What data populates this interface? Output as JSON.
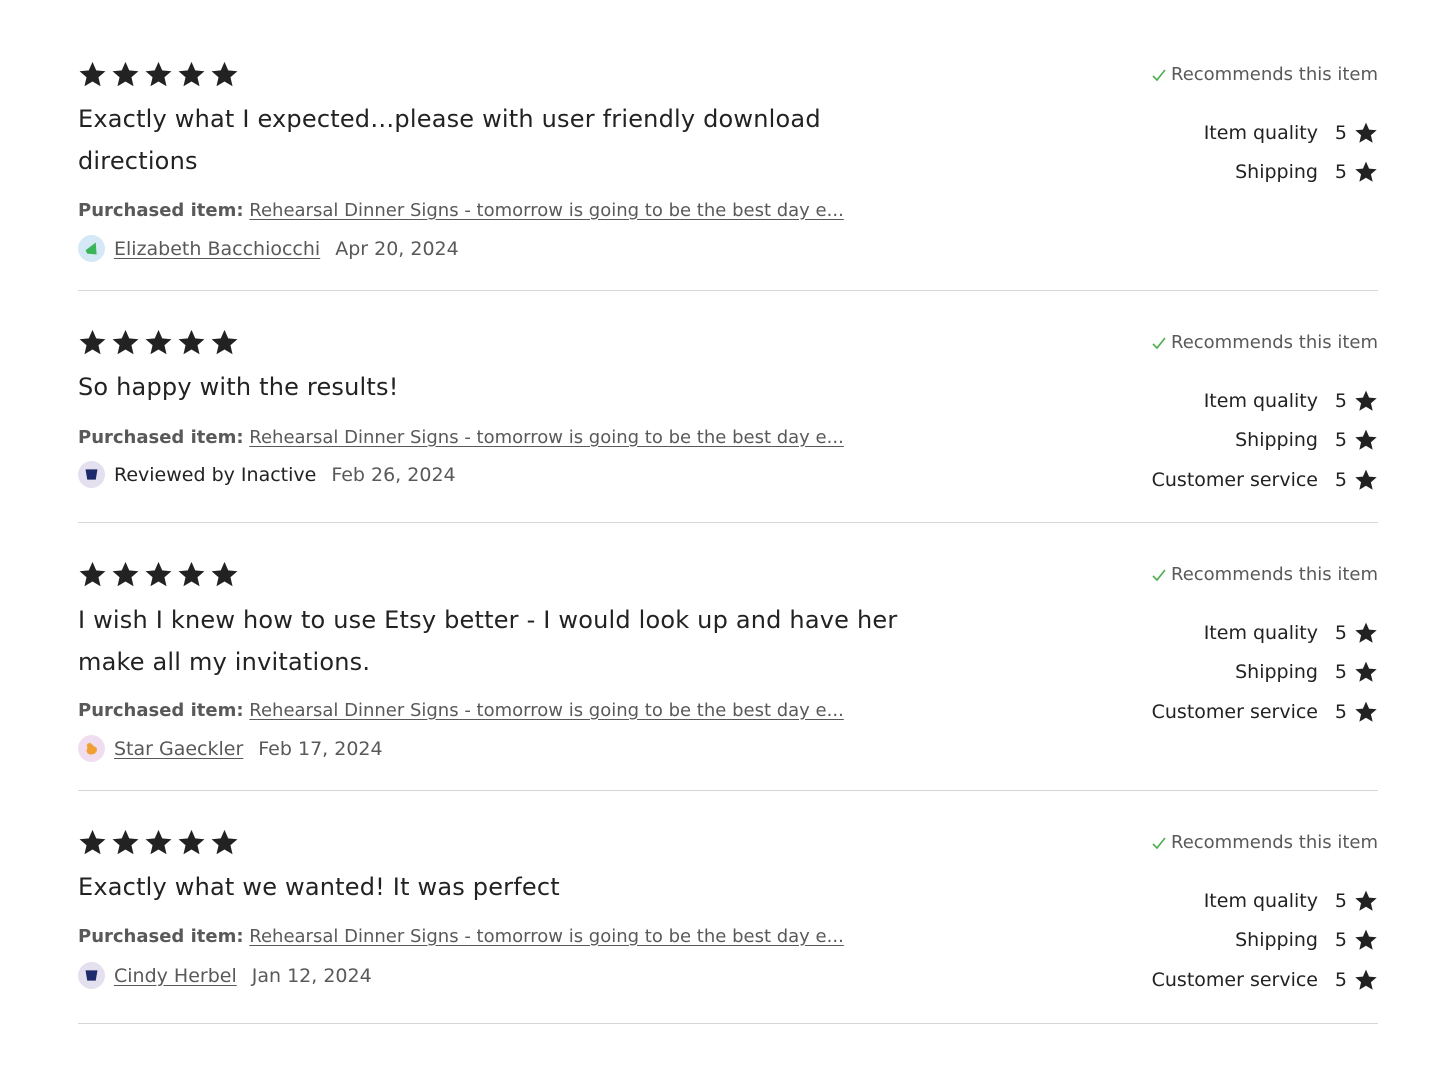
{
  "colors": {
    "star": "#222222",
    "check": "#4cae4c",
    "divider": "#d6d6d6",
    "muted": "#595959"
  },
  "reviews": [
    {
      "stars": 5,
      "text": "Exactly what I expected…please with user friendly download directions",
      "purchased_label": "Purchased item:",
      "item": "Rehearsal Dinner Signs - tomorrow is going to be the best day e...",
      "reviewer": "Elizabeth Bacchiocchi",
      "reviewer_linked": true,
      "avatar": {
        "icon": "green-leaf-icon",
        "bg": "#d5e8f5",
        "fg": "#3cb55a"
      },
      "date": "Apr 20, 2024",
      "recommends": "Recommends this item",
      "ratings": [
        {
          "label": "Item quality",
          "value": "5"
        },
        {
          "label": "Shipping",
          "value": "5"
        }
      ]
    },
    {
      "stars": 5,
      "text": "So happy with the results!",
      "purchased_label": "Purchased item:",
      "item": "Rehearsal Dinner Signs - tomorrow is going to be the best day e...",
      "reviewer": "Reviewed by Inactive",
      "reviewer_linked": false,
      "avatar": {
        "icon": "navy-shape-icon",
        "bg": "#e4e0ef",
        "fg": "#1d2a6b"
      },
      "date": "Feb 26, 2024",
      "recommends": "Recommends this item",
      "ratings": [
        {
          "label": "Item quality",
          "value": "5"
        },
        {
          "label": "Shipping",
          "value": "5"
        },
        {
          "label": "Customer service",
          "value": "5"
        }
      ]
    },
    {
      "stars": 5,
      "text": "I wish I knew how to use Etsy better - I would look up and have her make all my invitations.",
      "purchased_label": "Purchased item:",
      "item": "Rehearsal Dinner Signs - tomorrow is going to be the best day e...",
      "reviewer": "Star Gaeckler",
      "reviewer_linked": true,
      "avatar": {
        "icon": "orange-blob-icon",
        "bg": "#f1ddf0",
        "fg": "#f0a030"
      },
      "date": "Feb 17, 2024",
      "recommends": "Recommends this item",
      "ratings": [
        {
          "label": "Item quality",
          "value": "5"
        },
        {
          "label": "Shipping",
          "value": "5"
        },
        {
          "label": "Customer service",
          "value": "5"
        }
      ]
    },
    {
      "stars": 5,
      "text": "Exactly what we wanted! It was perfect",
      "purchased_label": "Purchased item:",
      "item": "Rehearsal Dinner Signs - tomorrow is going to be the best day e...",
      "reviewer": "Cindy Herbel",
      "reviewer_linked": true,
      "avatar": {
        "icon": "navy-shape-icon",
        "bg": "#e4e0ef",
        "fg": "#1d2a6b"
      },
      "date": "Jan 12, 2024",
      "recommends": "Recommends this item",
      "ratings": [
        {
          "label": "Item quality",
          "value": "5"
        },
        {
          "label": "Shipping",
          "value": "5"
        },
        {
          "label": "Customer service",
          "value": "5"
        }
      ]
    }
  ]
}
